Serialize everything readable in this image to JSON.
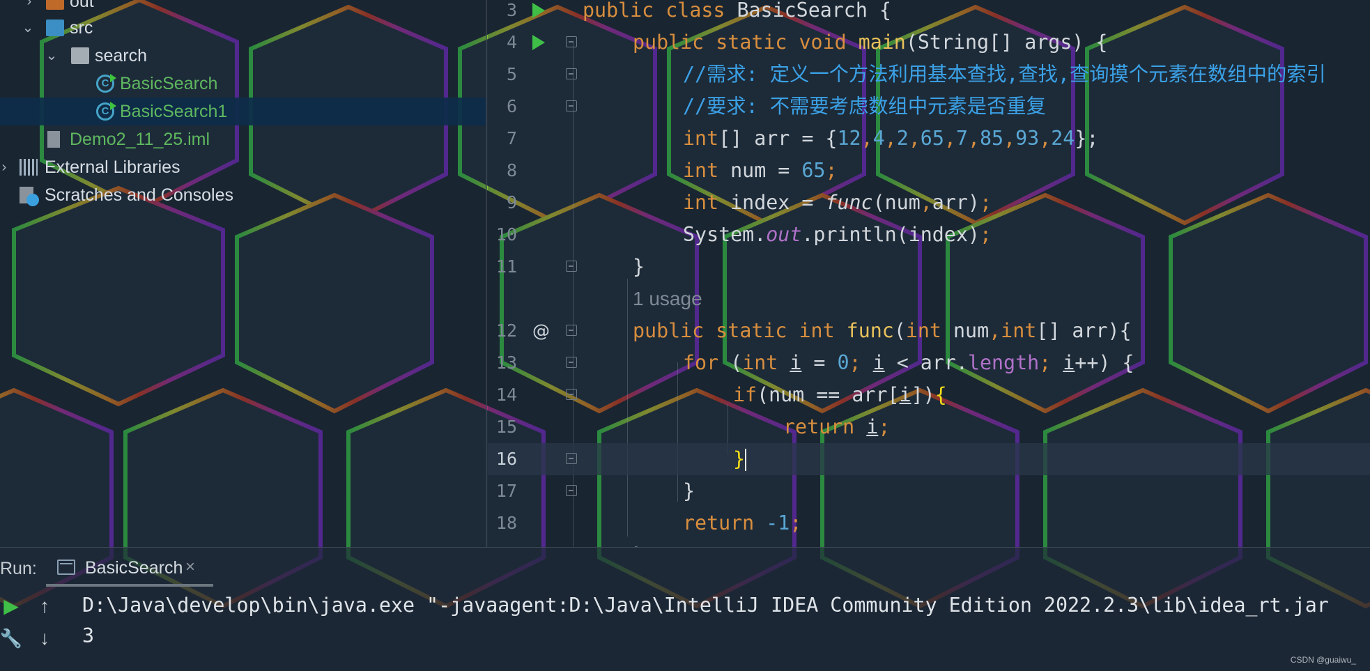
{
  "project_tree": {
    "items": [
      {
        "label": "out",
        "icon": "folder-icon"
      },
      {
        "label": "src",
        "icon": "folder-icon"
      },
      {
        "label": "search",
        "icon": "package-icon"
      },
      {
        "label": "BasicSearch",
        "icon": "class-icon"
      },
      {
        "label": "BasicSearch1",
        "icon": "class-icon"
      },
      {
        "label": "Demo2_11_25.iml",
        "icon": "module-file-icon"
      },
      {
        "label": "External Libraries",
        "icon": "libraries-icon"
      },
      {
        "label": "Scratches and Consoles",
        "icon": "scratches-icon"
      }
    ]
  },
  "editor": {
    "line_numbers": [
      "3",
      "4",
      "5",
      "6",
      "7",
      "8",
      "9",
      "10",
      "11",
      "12",
      "13",
      "14",
      "15",
      "16",
      "17",
      "18"
    ],
    "usage_hint": "1 usage",
    "lines": {
      "l3": {
        "kw": "public class ",
        "rest": "BasicSearch {"
      },
      "l4": {
        "kw": "public static void ",
        "fn": "main",
        "rest": "(String[] args) {"
      },
      "l5": "//需求: 定义一个方法利用基本查找,查找,查询摸个元素在数组中的索引",
      "l6": "//要求: 不需要考虑数组中元素是否重复",
      "l7": {
        "kw": "int",
        "a": "[] arr = {",
        "n1": "12",
        "n2": "4",
        "n3": "2",
        "n4": "65",
        "n5": "7",
        "n6": "85",
        "n7": "93",
        "n8": "24",
        "b": "};"
      },
      "l8": {
        "kw": "int",
        "a": " num = ",
        "n": "65",
        "b": ";"
      },
      "l9": {
        "kw": "int",
        "a": " index = ",
        "fn": "func",
        "b": "(num",
        "c": ",",
        "d": "arr)",
        "e": ";"
      },
      "l10": {
        "a": "System.",
        "fld": "out",
        "b": ".println(index)",
        "c": ";"
      },
      "l11": "}",
      "l12": {
        "kw": "public static int ",
        "fn": "func",
        "a": "(",
        "kw2": "int",
        "b": " num",
        "c": ",",
        "kw3": "int",
        "d": "[] arr){"
      },
      "l13": {
        "kw": "for",
        "a": " (",
        "kw2": "int",
        "sp": " ",
        "i": "i",
        "b": " = ",
        "n": "0",
        "c": "; ",
        "i2": "i",
        "d": " < arr.",
        "prop": "length",
        "e": "; ",
        "i3": "i",
        "f": "++) {"
      },
      "l14": {
        "kw": "if",
        "a": "(num == arr[",
        "i": "i",
        "b": "])",
        "brace": "{"
      },
      "l15": {
        "kw": "return ",
        "i": "i",
        "b": ";"
      },
      "l16": "}",
      "l17": "}",
      "l18": {
        "kw": "return ",
        "n": "-1",
        "b": ";"
      },
      "l19": "}"
    }
  },
  "run_panel": {
    "label": "Run:",
    "tab_label": "BasicSearch",
    "tab_close": "×",
    "console_lines": [
      "D:\\Java\\develop\\bin\\java.exe \"-javaagent:D:\\Java\\IntelliJ IDEA Community Edition 2022.2.3\\lib\\idea_rt.jar",
      "3"
    ]
  },
  "watermark": "CSDN @guaiwu_",
  "colors": {
    "keyword": "#d88e3e",
    "function": "#e8c05a",
    "number": "#5aa7d4",
    "comment": "#3ba1e6",
    "green_file": "#5fb85f"
  }
}
